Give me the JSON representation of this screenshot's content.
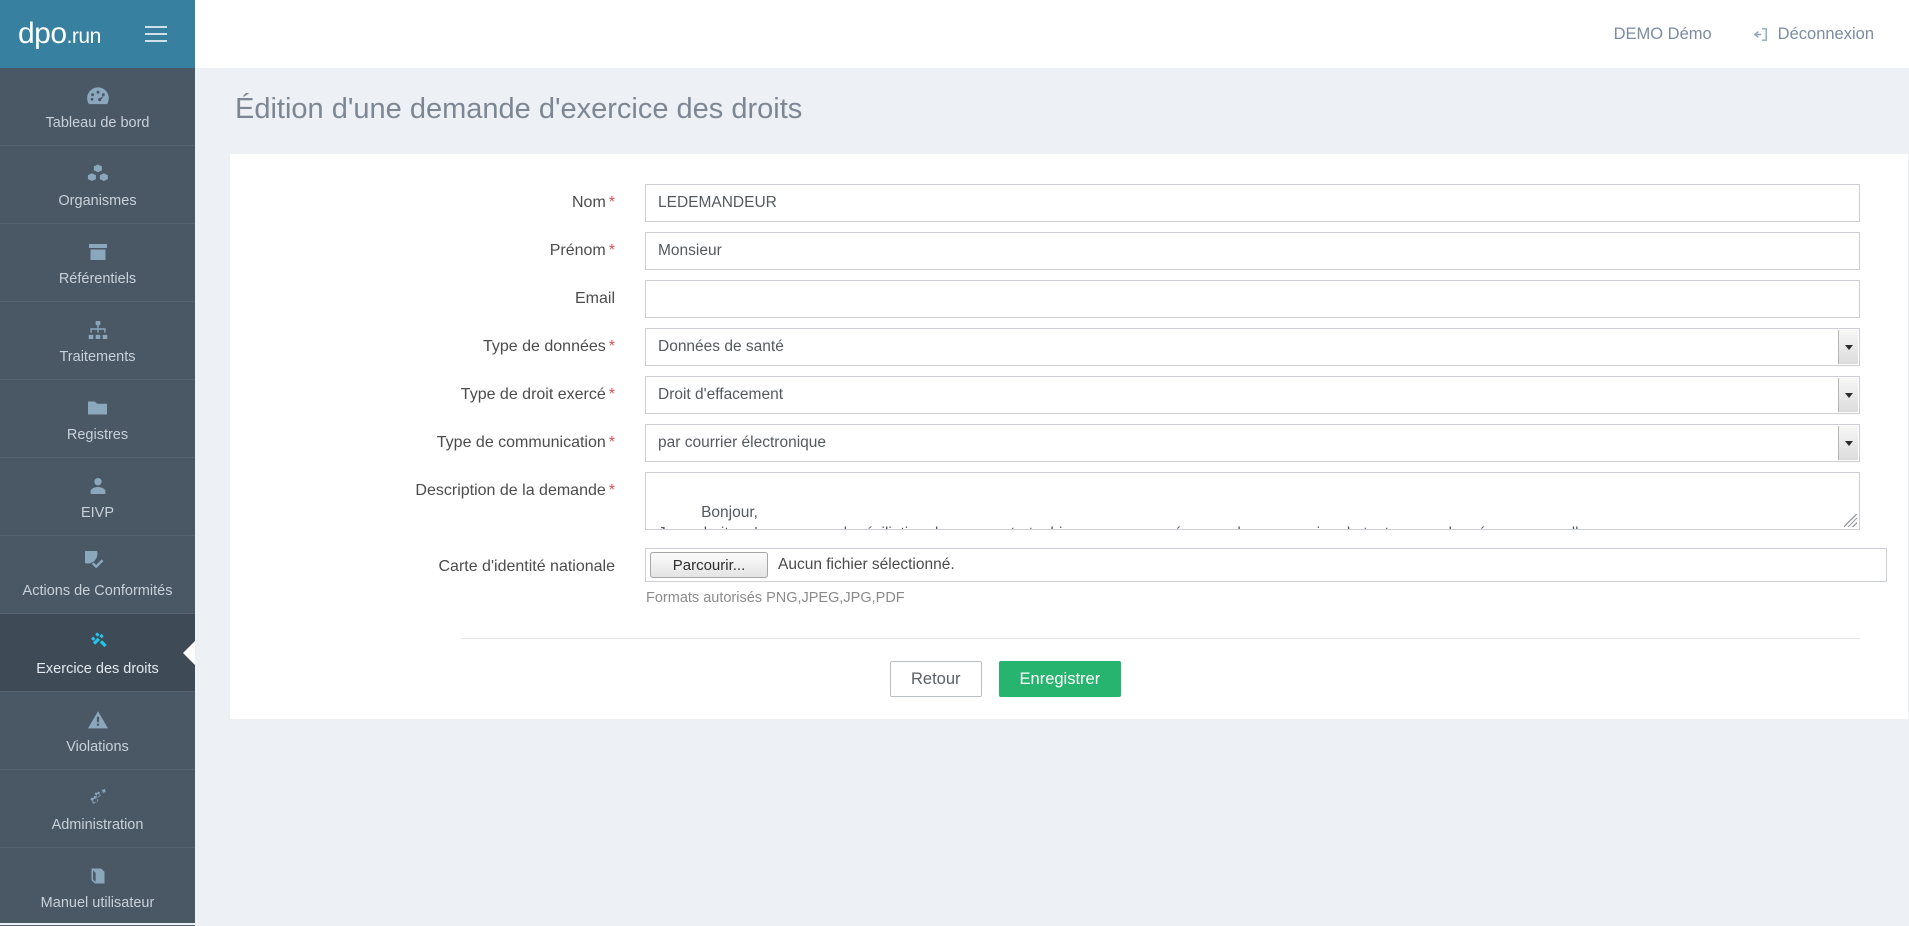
{
  "brand": {
    "logo_main": "dpo",
    "logo_suffix": ".run",
    "menu_icon": "hamburger-icon"
  },
  "topbar": {
    "user": "DEMO Démo",
    "logout_label": "Déconnexion",
    "logout_icon": "logout-icon"
  },
  "sidebar": {
    "items": [
      {
        "label": "Tableau de bord",
        "icon": "dashboard-icon",
        "active": false
      },
      {
        "label": "Organismes",
        "icon": "cubes-icon",
        "active": false
      },
      {
        "label": "Référentiels",
        "icon": "archive-box-icon",
        "active": false
      },
      {
        "label": "Traitements",
        "icon": "sitemap-icon",
        "active": false
      },
      {
        "label": "Registres",
        "icon": "folder-icon",
        "active": false
      },
      {
        "label": "EIVP",
        "icon": "user-icon",
        "active": false
      },
      {
        "label": "Actions de Conformités",
        "icon": "check-circle-icon",
        "active": false
      },
      {
        "label": "Exercice des droits",
        "icon": "gavel-icon",
        "active": true
      },
      {
        "label": "Violations",
        "icon": "warning-triangle-icon",
        "active": false
      },
      {
        "label": "Administration",
        "icon": "gears-icon",
        "active": false
      },
      {
        "label": "Manuel utilisateur",
        "icon": "book-icon",
        "active": false
      }
    ]
  },
  "page": {
    "title": "Édition d'une demande d'exercice des droits"
  },
  "form": {
    "required_mark": "*",
    "fields": {
      "nom": {
        "label": "Nom",
        "value": "LEDEMANDEUR",
        "required": true
      },
      "prenom": {
        "label": "Prénom",
        "value": "Monsieur",
        "required": true
      },
      "email": {
        "label": "Email",
        "value": "",
        "required": false
      },
      "type_donnees": {
        "label": "Type de données",
        "value": "Données de santé",
        "required": true
      },
      "type_droit": {
        "label": "Type de droit exercé",
        "value": "Droit d'effacement",
        "required": true
      },
      "type_communication": {
        "label": "Type de communication",
        "value": "par courrier électronique",
        "required": true
      },
      "description": {
        "label": "Description de la demande",
        "value": "Bonjour,\nJe souhaite m'assurer que la résiliation de mon contrat a bien eu pour conséquence la suppression de toutes mes données personnelles.",
        "required": true
      },
      "carte_identite": {
        "label": "Carte d'identité nationale",
        "browse_label": "Parcourir...",
        "no_file_text": "Aucun fichier sélectionné.",
        "hint": "Formats autorisés PNG,JPEG,JPG,PDF",
        "required": false
      }
    },
    "actions": {
      "back_label": "Retour",
      "save_label": "Enregistrer"
    }
  },
  "colors": {
    "brand_blue": "#37809f",
    "sidebar": "#4a5765",
    "sidebar_active": "#3f4a57",
    "accent_cyan": "#22c7ec",
    "save_green": "#27b46e",
    "required_red": "#d9534f",
    "page_bg": "#edf0f4"
  }
}
